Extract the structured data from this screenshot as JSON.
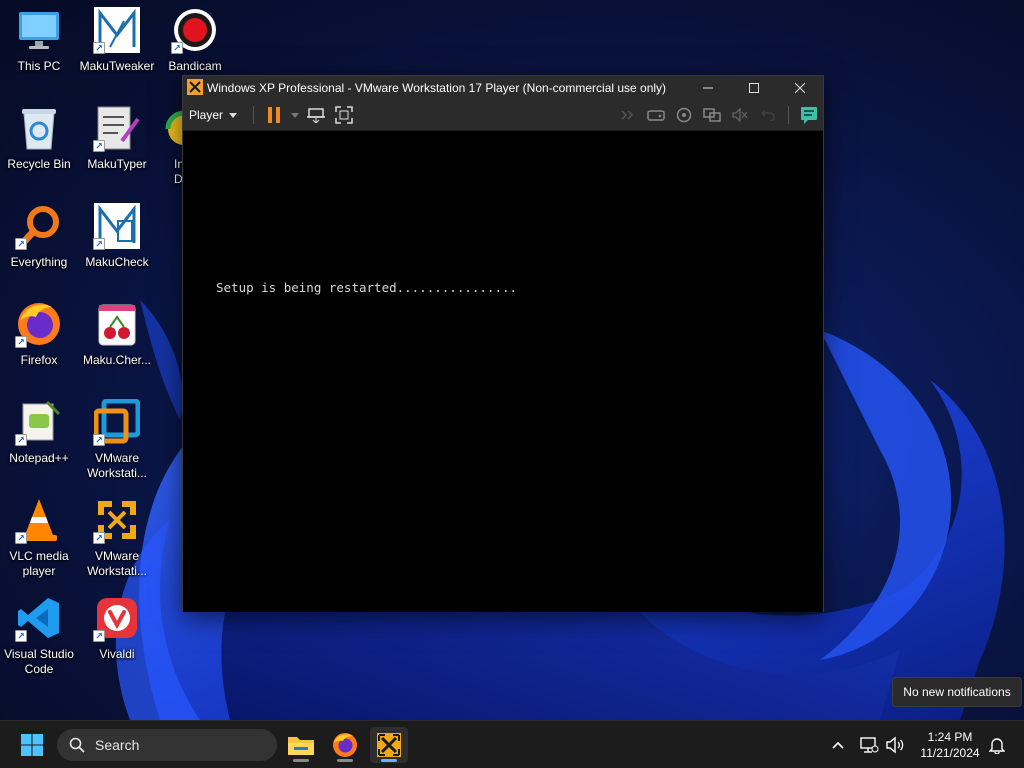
{
  "desktop": {
    "icons": [
      {
        "label": "This PC",
        "icon": "computer-icon"
      },
      {
        "label": "MakuTweaker",
        "icon": "makutweaker-icon"
      },
      {
        "label": "Bandicam",
        "icon": "bandicam-icon"
      },
      {
        "label": "Recycle Bin",
        "icon": "recycle-bin-icon"
      },
      {
        "label": "MakuTyper",
        "icon": "makutyper-icon"
      },
      {
        "label": "In Do",
        "icon": "partial-app-icon"
      },
      {
        "label": "Everything",
        "icon": "everything-search-icon"
      },
      {
        "label": "MakuCheck",
        "icon": "makucheck-icon"
      },
      {
        "label": "Firefox",
        "icon": "firefox-icon"
      },
      {
        "label": "Maku.Cher...",
        "icon": "cherry-app-icon"
      },
      {
        "label": "Notepad++",
        "icon": "notepadpp-icon"
      },
      {
        "label": "VMware Workstati...",
        "icon": "vmware-workstation-icon"
      },
      {
        "label": "VLC media player",
        "icon": "vlc-icon"
      },
      {
        "label": "VMware Workstati...",
        "icon": "vmware-player-icon"
      },
      {
        "label": "Visual Studio Code",
        "icon": "vscode-icon"
      },
      {
        "label": "Vivaldi",
        "icon": "vivaldi-icon"
      }
    ]
  },
  "vm_window": {
    "title": "Windows XP Professional - VMware Workstation 17 Player (Non-commercial use only)",
    "menu_label": "Player",
    "console_text": "Setup is being restarted................",
    "accent": "#f0a030"
  },
  "notification": {
    "text": "No new notifications"
  },
  "taskbar": {
    "search_label": "Search",
    "time": "1:24 PM",
    "date": "11/21/2024",
    "accent": "#5cb8ff"
  }
}
